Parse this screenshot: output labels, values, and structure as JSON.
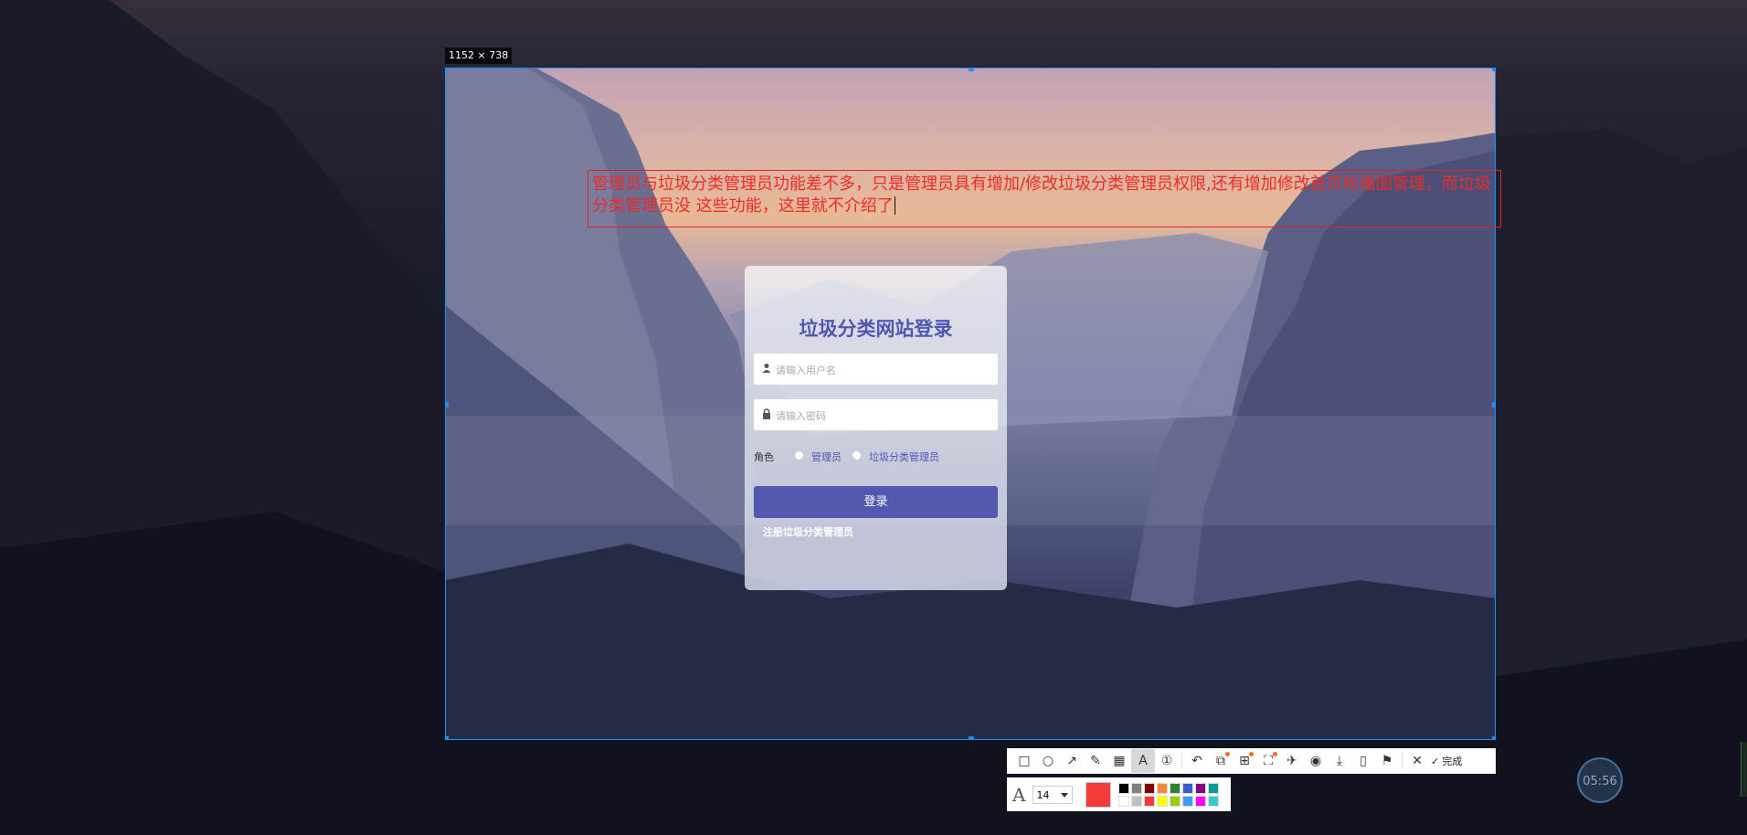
{
  "screenshot_tool": {
    "selection_size_label": "1152 × 738",
    "annotation_text": "管理员与垃圾分类管理员功能差不多，只是管理员具有增加/修改垃圾分类管理员权限,还有增加修改首页轮播图管理，而垃圾分类管理员没 这些功能，这里就不介绍了",
    "font_size": "14",
    "current_color": "#f43b3b",
    "palette": [
      "#000000",
      "#808080",
      "#800000",
      "#f7883a",
      "#308430",
      "#385ad3",
      "#800080",
      "#009999",
      "#ffffff",
      "#c0c0c0",
      "#f43b3b",
      "#ffff00",
      "#99cc00",
      "#3c99ff",
      "#ff00ff",
      "#33cccc"
    ],
    "tools": [
      {
        "name": "rectangle-tool-icon",
        "glyph": "□"
      },
      {
        "name": "ellipse-tool-icon",
        "glyph": "○"
      },
      {
        "name": "arrow-tool-icon",
        "glyph": "↗"
      },
      {
        "name": "pen-tool-icon",
        "glyph": "✎"
      },
      {
        "name": "mosaic-tool-icon",
        "glyph": "▦"
      },
      {
        "name": "text-tool-icon",
        "glyph": "A"
      },
      {
        "name": "number-tool-icon",
        "glyph": "①"
      },
      {
        "name": "undo-icon",
        "glyph": "↶"
      },
      {
        "name": "ocr-icon",
        "glyph": "⧉"
      },
      {
        "name": "translate-icon",
        "glyph": "⊞"
      },
      {
        "name": "long-capture-icon",
        "glyph": "⛶"
      },
      {
        "name": "pin-icon",
        "glyph": "✈"
      },
      {
        "name": "record-icon",
        "glyph": "◉"
      },
      {
        "name": "download-icon",
        "glyph": "⤓"
      },
      {
        "name": "phone-icon",
        "glyph": "▯"
      },
      {
        "name": "bookmark-icon",
        "glyph": "⚑"
      },
      {
        "name": "close-icon",
        "glyph": "✕"
      }
    ],
    "done_label": "完成",
    "timer": "05:56"
  },
  "login": {
    "title": "垃圾分类网站登录",
    "username_placeholder": "请输入用户名",
    "password_placeholder": "请输入密码",
    "role_label": "角色",
    "role_options": [
      "管理员",
      "垃圾分类管理员"
    ],
    "login_button": "登录",
    "register_link": "注册垃圾分类管理员"
  }
}
